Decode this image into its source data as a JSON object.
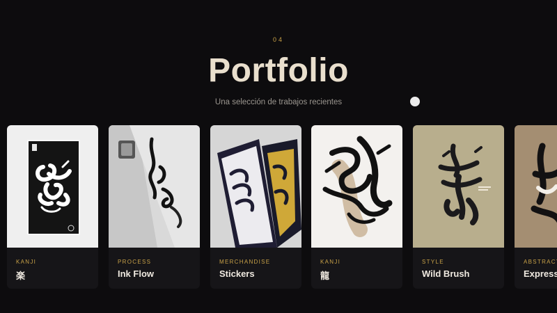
{
  "section": {
    "number": "04",
    "title": "Portfolio",
    "subtitle": "Una selección de trabajos recientes"
  },
  "cards": [
    {
      "category": "KANJI",
      "title": "楽",
      "image": "raku-poster"
    },
    {
      "category": "PROCESS",
      "title": "Ink Flow",
      "image": "ink-flow-photo"
    },
    {
      "category": "MERCHANDISE",
      "title": "Stickers",
      "image": "stickers-photo"
    },
    {
      "category": "KANJI",
      "title": "龍",
      "image": "ryu-calligraphy"
    },
    {
      "category": "STYLE",
      "title": "Wild Brush",
      "image": "wild-brush-poster"
    },
    {
      "category": "ABSTRACT",
      "title": "Express",
      "image": "abstract-calligraphy"
    }
  ],
  "colors": {
    "background": "#0d0c0e",
    "accent": "#c9a248",
    "title": "#e9dfcd",
    "card": "#161518"
  }
}
